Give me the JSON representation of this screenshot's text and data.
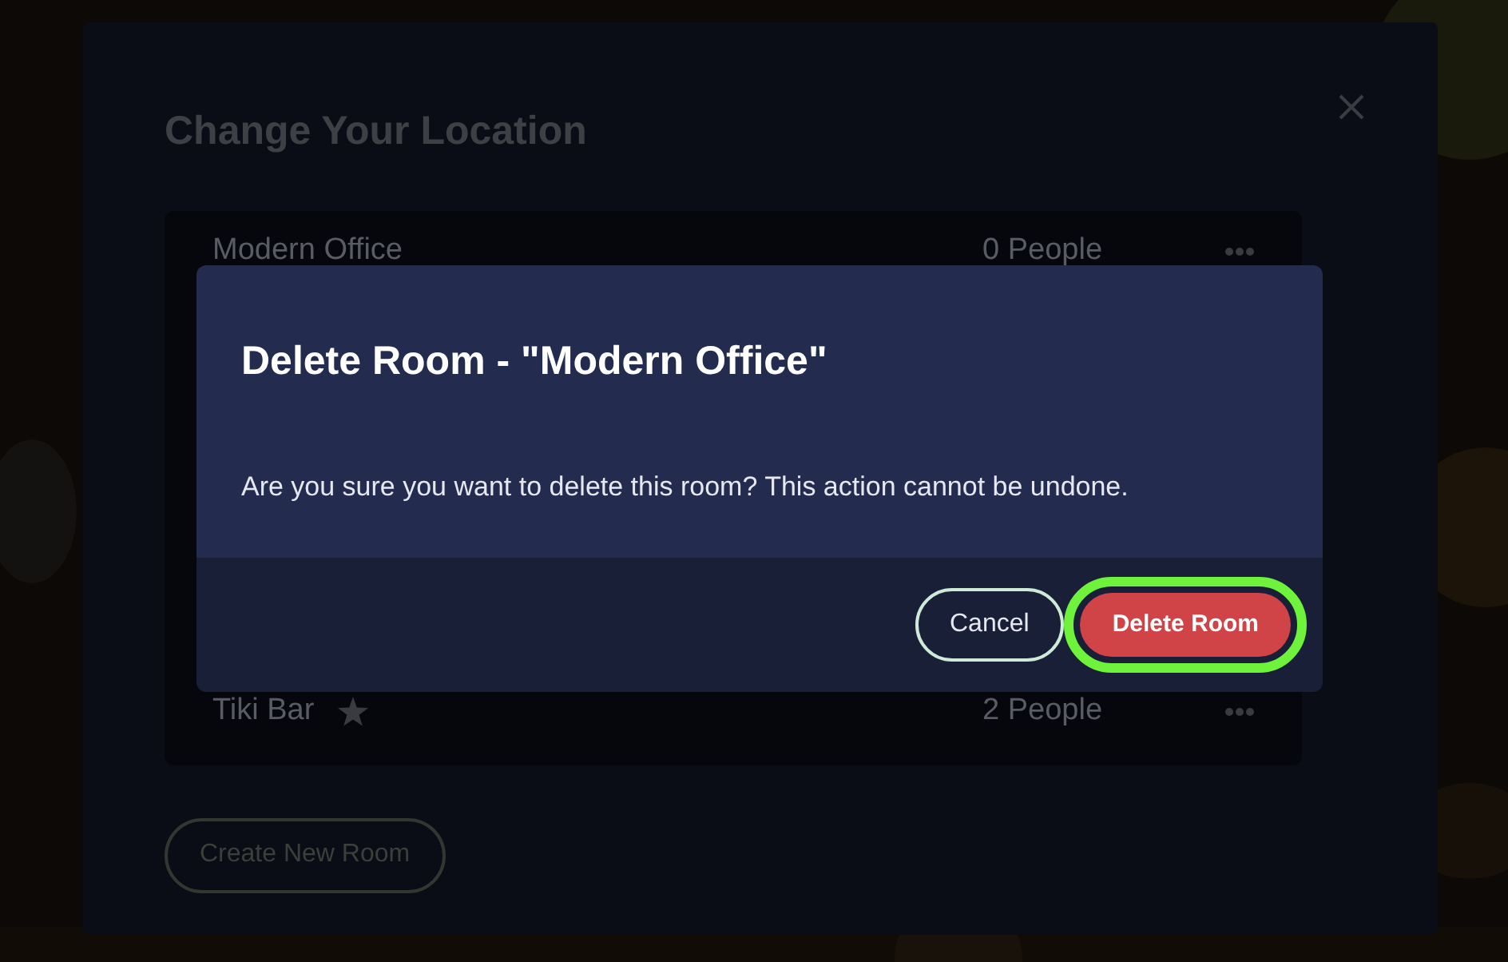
{
  "panel": {
    "title": "Change Your Location",
    "rooms": [
      {
        "name": "Modern Office",
        "favorite": false,
        "people": "0 People"
      },
      {
        "name": "Tiki Bar",
        "favorite": true,
        "people": "2 People"
      }
    ],
    "create_button": "Create New Room"
  },
  "dialog": {
    "title": "Delete Room - \"Modern Office\"",
    "message": "Are you sure you want to delete this room? This action cannot be undone.",
    "buttons": [
      {
        "label": "Cancel",
        "kind": "secondary",
        "highlighted": false
      },
      {
        "label": "Delete Room",
        "kind": "danger",
        "highlighted": true
      }
    ]
  }
}
